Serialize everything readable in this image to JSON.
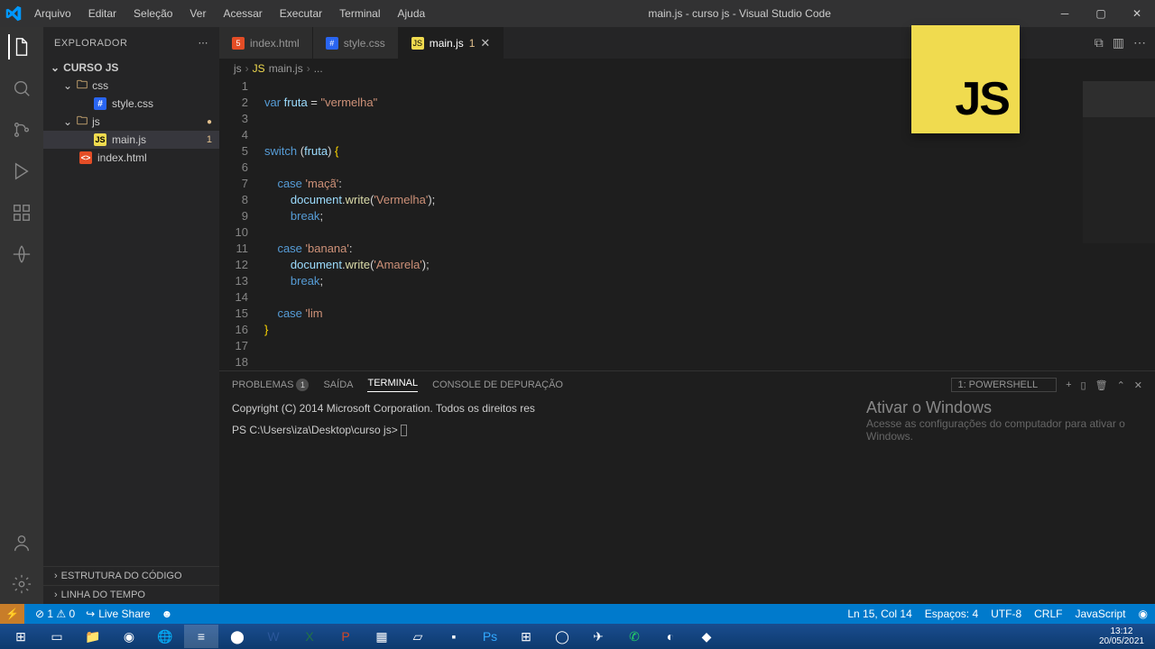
{
  "window": {
    "title": "main.js - curso js - Visual Studio Code"
  },
  "menu": [
    "Arquivo",
    "Editar",
    "Seleção",
    "Ver",
    "Acessar",
    "Executar",
    "Terminal",
    "Ajuda"
  ],
  "sidebar": {
    "header": "EXPLORADOR",
    "root": "CURSO JS",
    "folders": [
      {
        "name": "css",
        "children": [
          {
            "name": "style.css",
            "icon": "css"
          }
        ]
      },
      {
        "name": "js",
        "modified": true,
        "children": [
          {
            "name": "main.js",
            "icon": "js",
            "badge": "1",
            "selected": true
          }
        ]
      }
    ],
    "rootFiles": [
      {
        "name": "index.html",
        "icon": "html"
      }
    ],
    "sections": [
      "ESTRUTURA DO CÓDIGO",
      "LINHA DO TEMPO"
    ]
  },
  "tabs": [
    {
      "name": "index.html",
      "icon": "html"
    },
    {
      "name": "style.css",
      "icon": "css"
    },
    {
      "name": "main.js",
      "icon": "js",
      "active": true,
      "badge": "1",
      "modified": true
    }
  ],
  "breadcrumb": [
    "js",
    "main.js",
    "..."
  ],
  "code": {
    "lines": [
      {
        "n": 1,
        "seg": []
      },
      {
        "n": 2,
        "seg": [
          [
            "kw",
            "var "
          ],
          [
            "var",
            "fruta"
          ],
          [
            "p",
            " = "
          ],
          [
            "str",
            "\"vermelha\""
          ]
        ]
      },
      {
        "n": 3,
        "seg": []
      },
      {
        "n": 4,
        "seg": []
      },
      {
        "n": 5,
        "seg": [
          [
            "kw",
            "switch "
          ],
          [
            "p",
            "("
          ],
          [
            "var",
            "fruta"
          ],
          [
            "p",
            ") "
          ],
          [
            "br",
            "{"
          ]
        ]
      },
      {
        "n": 6,
        "seg": []
      },
      {
        "n": 7,
        "seg": [
          [
            "p",
            "    "
          ],
          [
            "kw",
            "case "
          ],
          [
            "str",
            "'maçã'"
          ],
          [
            "p",
            ":"
          ]
        ]
      },
      {
        "n": 8,
        "seg": [
          [
            "p",
            "        "
          ],
          [
            "var",
            "document"
          ],
          [
            "p",
            "."
          ],
          [
            "fn",
            "write"
          ],
          [
            "p",
            "("
          ],
          [
            "str",
            "'Vermelha'"
          ],
          [
            "p",
            ");"
          ]
        ]
      },
      {
        "n": 9,
        "seg": [
          [
            "p",
            "        "
          ],
          [
            "kw",
            "break"
          ],
          [
            "p",
            ";"
          ]
        ]
      },
      {
        "n": 10,
        "seg": []
      },
      {
        "n": 11,
        "seg": [
          [
            "p",
            "    "
          ],
          [
            "kw",
            "case "
          ],
          [
            "str",
            "'banana'"
          ],
          [
            "p",
            ":"
          ]
        ]
      },
      {
        "n": 12,
        "seg": [
          [
            "p",
            "        "
          ],
          [
            "var",
            "document"
          ],
          [
            "p",
            "."
          ],
          [
            "fn",
            "write"
          ],
          [
            "p",
            "("
          ],
          [
            "str",
            "'Amarela'"
          ],
          [
            "p",
            ");"
          ]
        ]
      },
      {
        "n": 13,
        "seg": [
          [
            "p",
            "        "
          ],
          [
            "kw",
            "break"
          ],
          [
            "p",
            ";"
          ]
        ]
      },
      {
        "n": 14,
        "seg": []
      },
      {
        "n": 15,
        "seg": [
          [
            "p",
            "    "
          ],
          [
            "kw",
            "case "
          ],
          [
            "str",
            "'lim"
          ]
        ]
      },
      {
        "n": 16,
        "seg": [
          [
            "br",
            "}"
          ]
        ]
      },
      {
        "n": 17,
        "seg": []
      },
      {
        "n": 18,
        "seg": []
      }
    ]
  },
  "terminal": {
    "tabs": [
      {
        "label": "PROBLEMAS",
        "badge": "1"
      },
      {
        "label": "SAÍDA"
      },
      {
        "label": "TERMINAL",
        "active": true
      },
      {
        "label": "CONSOLE DE DEPURAÇÃO"
      }
    ],
    "shell": "1: powershell",
    "copyright": "Copyright (C) 2014 Microsoft Corporation. Todos os direitos res",
    "prompt": "PS C:\\Users\\iza\\Desktop\\curso js> ",
    "watermark": {
      "title": "Ativar o Windows",
      "sub": "Acesse as configurações do computador para ativar o Windows."
    }
  },
  "status": {
    "left": [
      "⊘ 1 ⚠ 0",
      "Live Share"
    ],
    "right": [
      "Ln 15, Col 14",
      "Espaços: 4",
      "UTF-8",
      "CRLF",
      "JavaScript",
      "◉"
    ]
  },
  "clock": {
    "time": "13:12",
    "date": "20/05/2021"
  },
  "jslogo": "JS"
}
